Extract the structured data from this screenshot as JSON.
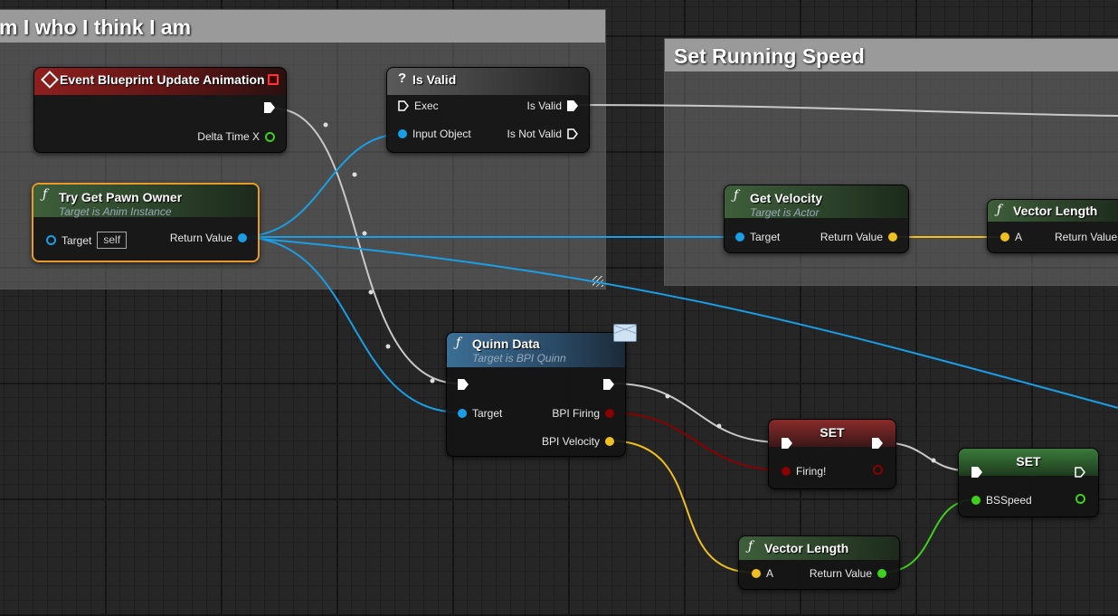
{
  "comments": {
    "left_title": "m I who I think I am",
    "right_title": "Set Running Speed"
  },
  "nodes": {
    "event_update": {
      "title": "Event Blueprint Update Animation",
      "delta_label": "Delta Time X"
    },
    "is_valid": {
      "title": "Is Valid",
      "exec": "Exec",
      "is_valid": "Is Valid",
      "input_object": "Input Object",
      "is_not_valid": "Is Not Valid"
    },
    "try_get_pawn": {
      "title": "Try Get Pawn Owner",
      "subtitle": "Target is Anim Instance",
      "target": "Target",
      "self": "self",
      "return_value": "Return Value"
    },
    "get_velocity": {
      "title": "Get Velocity",
      "subtitle": "Target is Actor",
      "target": "Target",
      "return_value": "Return Value"
    },
    "vector_length_top": {
      "title": "Vector Length",
      "a": "A",
      "return_value": "Return Value"
    },
    "quinn_data": {
      "title": "Quinn Data",
      "subtitle": "Target is BPI Quinn",
      "target": "Target",
      "bpi_firing": "BPI Firing",
      "bpi_velocity": "BPI Velocity"
    },
    "set_firing": {
      "title": "SET",
      "var": "Firing!"
    },
    "set_bsspeed": {
      "title": "SET",
      "var": "BSSpeed"
    },
    "vector_length_bottom": {
      "title": "Vector Length",
      "a": "A",
      "return_value": "Return Value"
    }
  },
  "icons": {
    "function": "ƒ",
    "question": "?"
  },
  "colors": {
    "exec_wire": "#c8c8c8",
    "object_pin": "#1a9ee6",
    "vector_pin": "#f0c020",
    "bool_pin": "#8a0000",
    "float_pin": "#3fcf1f",
    "selected_outline": "#e89b2a"
  }
}
